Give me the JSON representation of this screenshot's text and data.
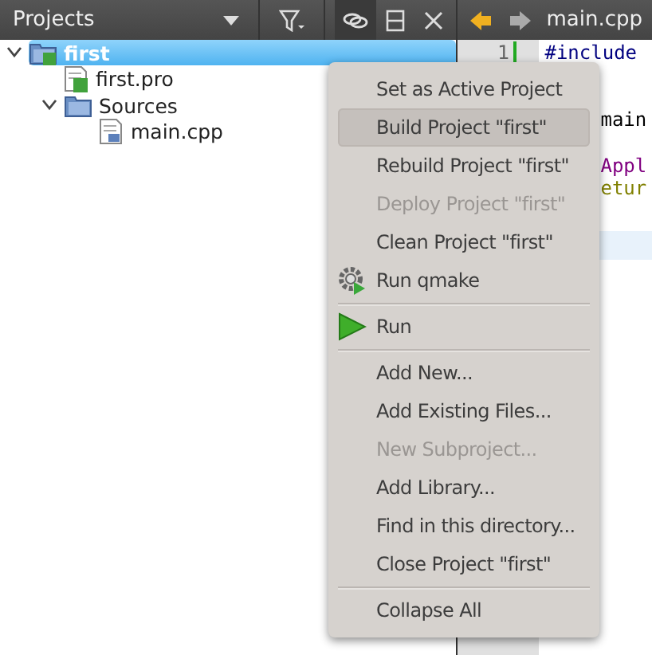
{
  "projects_pane": {
    "title": "Projects",
    "tree": [
      {
        "label": "first",
        "kind": "project",
        "selected": true,
        "expanded": true,
        "children": [
          {
            "label": "first.pro",
            "kind": "profile",
            "selected": false
          },
          {
            "label": "Sources",
            "kind": "folder",
            "selected": false,
            "expanded": true,
            "children": [
              {
                "label": "main.cpp",
                "kind": "source",
                "selected": false
              }
            ]
          }
        ]
      }
    ]
  },
  "editor": {
    "tab": "main.cpp",
    "line_numbers": [
      "1"
    ],
    "code_lines": [
      {
        "text": "#include",
        "kind": "directive"
      },
      {
        "text": "main",
        "kind": "plain"
      },
      {
        "text": "Appl",
        "kind": "type"
      },
      {
        "text": "etur",
        "kind": "keyword"
      }
    ]
  },
  "context_menu": {
    "items": [
      {
        "kind": "item",
        "label": "Set as Active Project",
        "selected": false,
        "disabled": false
      },
      {
        "kind": "item",
        "label": "Build Project \"first\"",
        "selected": true,
        "disabled": false
      },
      {
        "kind": "item",
        "label": "Rebuild Project \"first\"",
        "selected": false,
        "disabled": false
      },
      {
        "kind": "item",
        "label": "Deploy Project \"first\"",
        "selected": false,
        "disabled": true
      },
      {
        "kind": "item",
        "label": "Clean Project \"first\"",
        "selected": false,
        "disabled": false
      },
      {
        "kind": "gear",
        "label": "Run qmake",
        "selected": false,
        "disabled": false
      },
      {
        "kind": "separator"
      },
      {
        "kind": "play",
        "label": "Run",
        "selected": false,
        "disabled": false
      },
      {
        "kind": "separator"
      },
      {
        "kind": "item",
        "label": "Add New...",
        "selected": false,
        "disabled": false
      },
      {
        "kind": "item",
        "label": "Add Existing Files...",
        "selected": false,
        "disabled": false
      },
      {
        "kind": "item",
        "label": "New Subproject...",
        "selected": false,
        "disabled": true
      },
      {
        "kind": "item",
        "label": "Add Library...",
        "selected": false,
        "disabled": false
      },
      {
        "kind": "item",
        "label": "Find in this directory...",
        "selected": false,
        "disabled": false
      },
      {
        "kind": "item",
        "label": "Close Project \"first\"",
        "selected": false,
        "disabled": false
      },
      {
        "kind": "separator"
      },
      {
        "kind": "item",
        "label": "Collapse All",
        "selected": false,
        "disabled": false
      }
    ]
  }
}
